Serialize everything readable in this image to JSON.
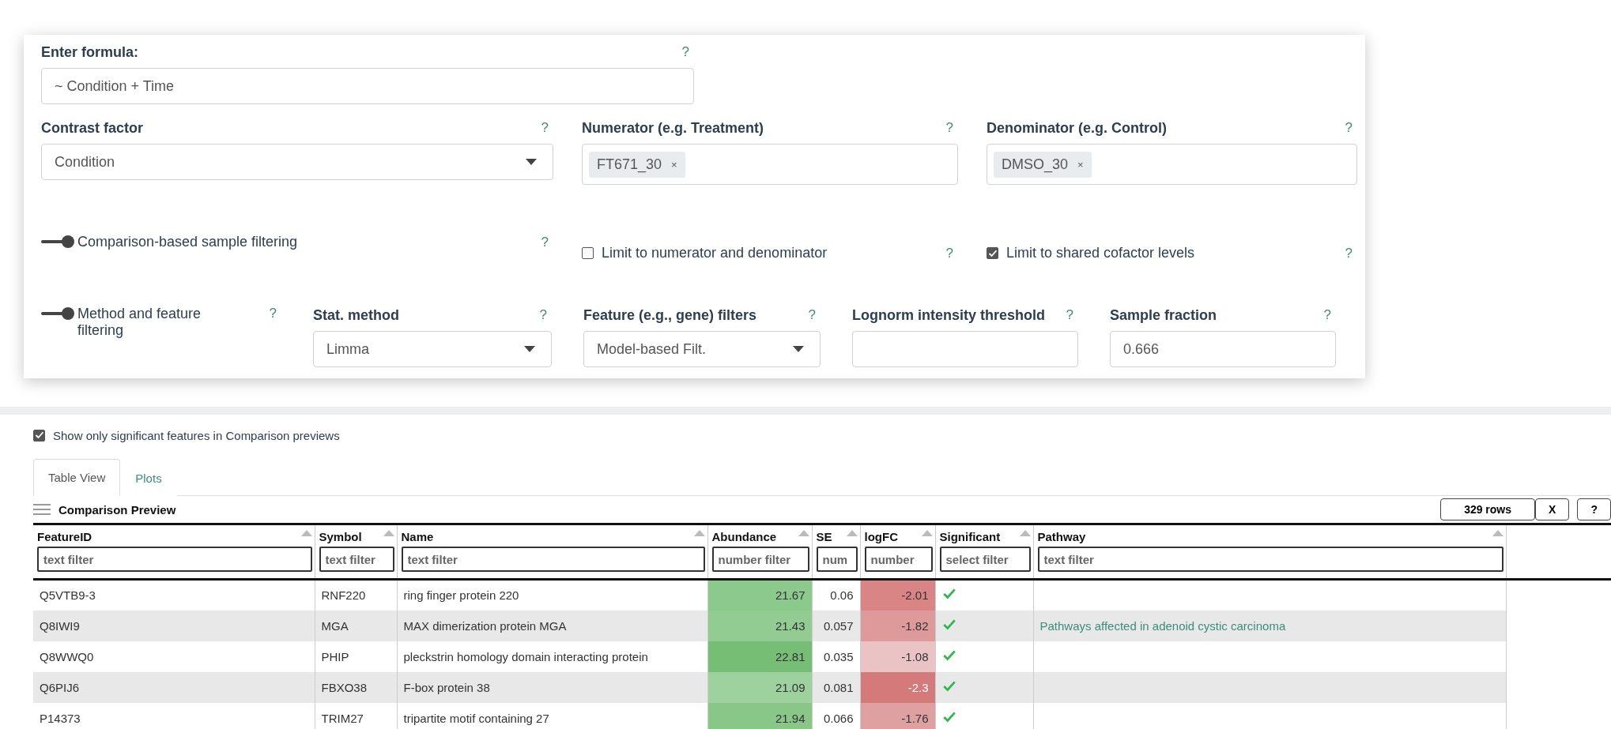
{
  "settings": {
    "formula": {
      "label": "Enter formula:",
      "help": "?",
      "value": "~ Condition + Time"
    },
    "contrast": {
      "label": "Contrast factor",
      "help": "?",
      "value": "Condition"
    },
    "numerator": {
      "label": "Numerator (e.g. Treatment)",
      "help": "?",
      "tags": [
        "FT671_30"
      ],
      "remove": "×"
    },
    "denominator": {
      "label": "Denominator (e.g. Control)",
      "help": "?",
      "tags": [
        "DMSO_30"
      ],
      "remove": "×"
    },
    "sample_filtering": {
      "label": "Comparison-based sample filtering",
      "help": "?",
      "on": true
    },
    "limit_numerator": {
      "label": "Limit to numerator and denominator",
      "help": "?",
      "checked": false
    },
    "limit_cofactor": {
      "label": "Limit to shared cofactor levels",
      "help": "?",
      "checked": true
    },
    "method_filtering": {
      "label": "Method and feature filtering",
      "help": "?",
      "on": true
    },
    "stat_method": {
      "label": "Stat. method",
      "help": "?",
      "value": "Limma"
    },
    "feature_filters": {
      "label": "Feature (e.g., gene) filters",
      "help": "?",
      "value": "Model-based Filt."
    },
    "lognorm": {
      "label": "Lognorm intensity threshold",
      "help": "?"
    },
    "sample_fraction": {
      "label": "Sample fraction",
      "help": "?",
      "value": "0.666"
    }
  },
  "significant_only": {
    "label": "Show only significant features in Comparison previews",
    "checked": true
  },
  "tabs": [
    {
      "label": "Table View",
      "selected": true
    },
    {
      "label": "Plots",
      "selected": false
    }
  ],
  "table": {
    "title": "Comparison Preview",
    "row_count": "329 rows",
    "close": "X",
    "help": "?",
    "columns": [
      {
        "label": "FeatureID",
        "placeholder": "text filter"
      },
      {
        "label": "Symbol",
        "placeholder": "text filter"
      },
      {
        "label": "Name",
        "placeholder": "text filter"
      },
      {
        "label": "Abundance",
        "placeholder": "number filter"
      },
      {
        "label": "SE",
        "placeholder": "num"
      },
      {
        "label": "logFC",
        "placeholder": "number"
      },
      {
        "label": "Significant",
        "placeholder": "select filter"
      },
      {
        "label": "Pathway",
        "placeholder": "text filter"
      }
    ],
    "rows": [
      {
        "id": "Q5VTB9-3",
        "symbol": "RNF220",
        "name": "ring finger protein 220",
        "abundance": {
          "text": "21.67",
          "color": "#8cc98c"
        },
        "se": "0.06",
        "logfc": {
          "text": "-2.01",
          "color": "#d98585"
        },
        "significant": true
      },
      {
        "id": "Q8IWI9",
        "symbol": "MGA",
        "name": "MAX dimerization protein MGA",
        "abundance": {
          "text": "21.43",
          "color": "#92cc92"
        },
        "se": "0.057",
        "logfc": {
          "text": "-1.82",
          "color": "#de9a9a"
        },
        "significant": true,
        "pathway": "Pathways affected in adenoid cystic carcinoma"
      },
      {
        "id": "Q8WWQ0",
        "symbol": "PHIP",
        "name": "pleckstrin homology domain interacting protein",
        "abundance": {
          "text": "22.81",
          "color": "#76bd76"
        },
        "se": "0.035",
        "logfc": {
          "text": "-1.08",
          "color": "#eac4c4"
        },
        "significant": true
      },
      {
        "id": "Q6PIJ6",
        "symbol": "FBXO38",
        "name": "F-box protein 38",
        "abundance": {
          "text": "21.09",
          "color": "#9dd19d"
        },
        "se": "0.081",
        "logfc": {
          "text": "-2.3",
          "color": "#d57a7a"
        },
        "significant": true
      },
      {
        "id": "P14373",
        "symbol": "TRIM27",
        "name": "tripartite motif containing 27",
        "abundance": {
          "text": "21.94",
          "color": "#89c789"
        },
        "se": "0.066",
        "logfc": {
          "text": "-1.76",
          "color": "#dea0a0"
        },
        "significant": true
      }
    ]
  }
}
